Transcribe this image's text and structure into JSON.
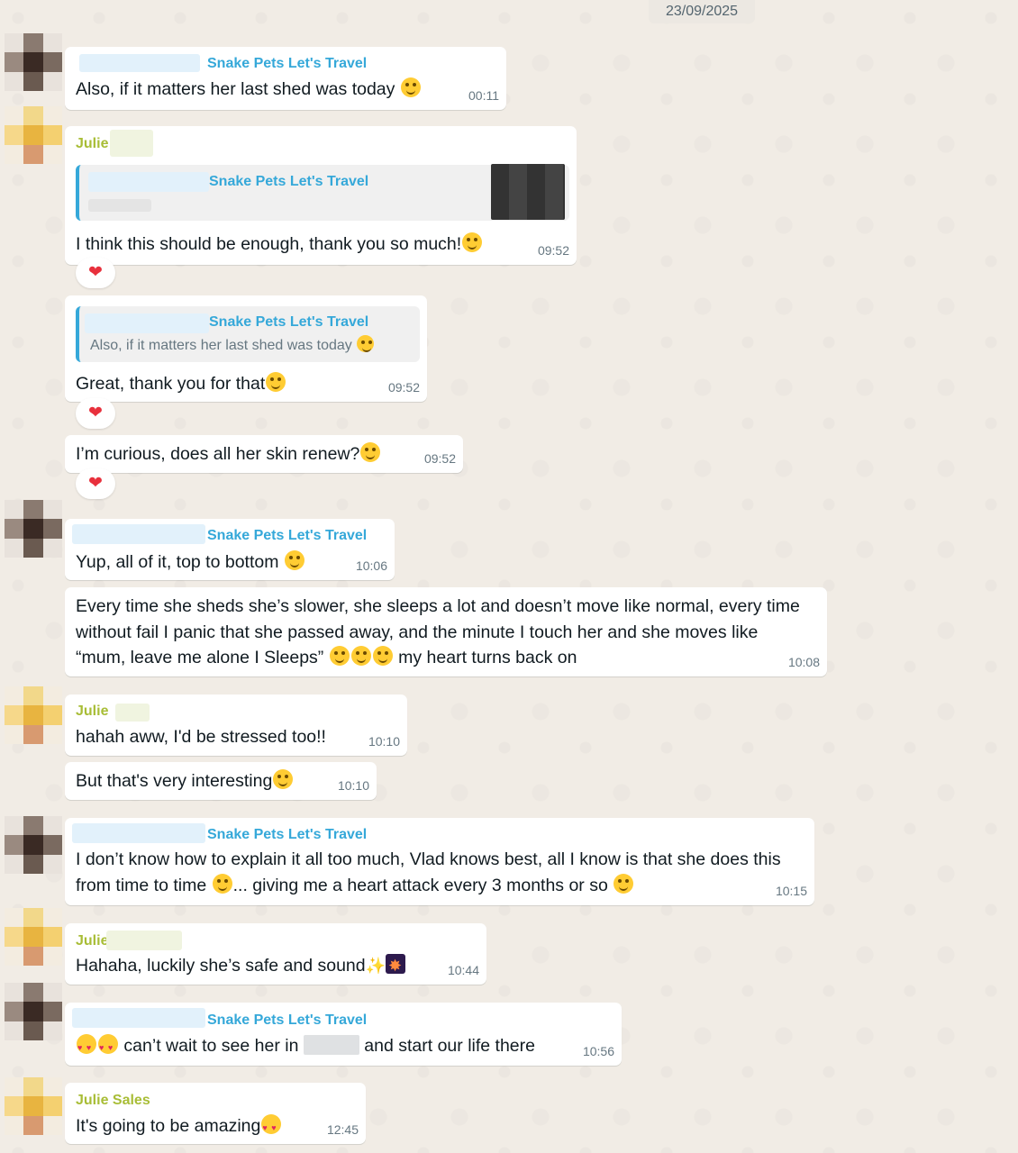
{
  "date_divider": "23/09/2025",
  "messages": {
    "m1": {
      "sender": "Snake Pets Let's Travel",
      "text": "Also, if it matters her last shed was today",
      "time": "00:11"
    },
    "m2": {
      "sender": "Julie",
      "quote_sender": "Snake Pets Let's Travel",
      "text": "I think this should be enough, thank you so much!",
      "time": "09:52",
      "reaction": "❤"
    },
    "m3": {
      "quote_sender": "Snake Pets Let's Travel",
      "quote_text": "Also, if it matters her last shed was today",
      "text": "Great, thank you for that",
      "time": "09:52",
      "reaction": "❤"
    },
    "m4": {
      "text": "I’m curious, does all her skin renew?",
      "time": "09:52",
      "reaction": "❤"
    },
    "m5": {
      "sender": "Snake Pets Let's Travel",
      "text": "Yup, all of it, top to bottom",
      "time": "10:06"
    },
    "m6": {
      "text_a": "Every time she sheds she’s slower, she sleeps a lot and doesn’t move like normal, every time without fail I panic that she passed away, and the minute I touch her and she moves like “mum, leave me alone I Sleeps”",
      "text_b": "my heart turns back on",
      "time": "10:08"
    },
    "m7": {
      "sender": "Julie",
      "text": "hahah aww, I'd be stressed too!!",
      "time": "10:10"
    },
    "m8": {
      "text": "But that's very interesting",
      "time": "10:10"
    },
    "m9": {
      "sender": "Snake Pets Let's Travel",
      "text_a": "I don’t know how to explain it all too much, Vlad knows best, all I know is that she does this from time to time",
      "text_b": "... giving me a heart attack every 3 months or so",
      "time": "10:15"
    },
    "m10": {
      "sender": "Julie",
      "text": "Hahaha, luckily she’s safe and sound",
      "time": "10:44"
    },
    "m11": {
      "sender": "Snake Pets Let's Travel",
      "text_a": "can’t wait to see her in",
      "text_b": "and start our life there",
      "time": "10:56"
    },
    "m12": {
      "sender": "Julie Sales",
      "text": "It's going to be amazing",
      "time": "12:45"
    }
  },
  "colors": {
    "sender_blue": "#35a8d9",
    "sender_green": "#a8bd36",
    "reaction_heart": "#e8303c"
  }
}
